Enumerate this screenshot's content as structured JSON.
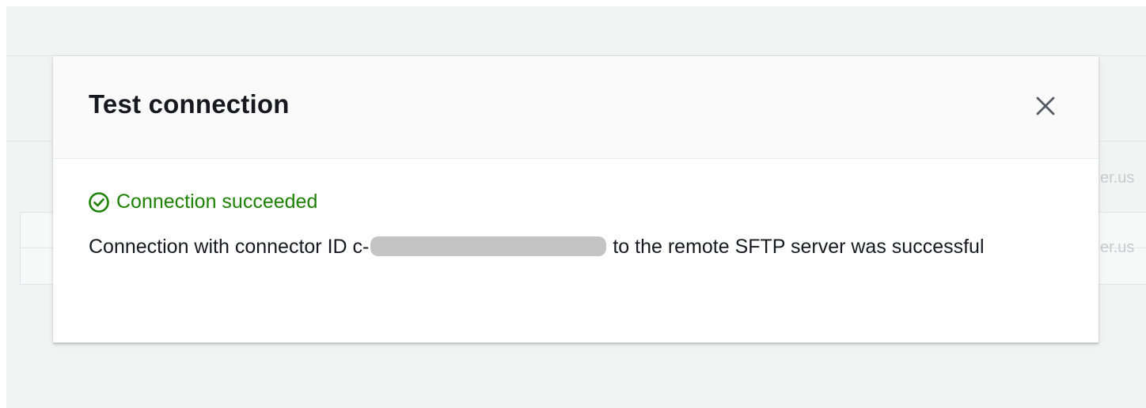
{
  "background": {
    "cell_fragments": [
      "er.us",
      "er.us"
    ]
  },
  "dialog": {
    "title": "Test connection",
    "close_icon": "close-icon",
    "status": {
      "icon": "check-circle-icon",
      "text": "Connection succeeded",
      "color": "#1d8102"
    },
    "message": {
      "prefix": "Connection with connector ID c-",
      "suffix": "to the remote SFTP server was successful"
    }
  }
}
